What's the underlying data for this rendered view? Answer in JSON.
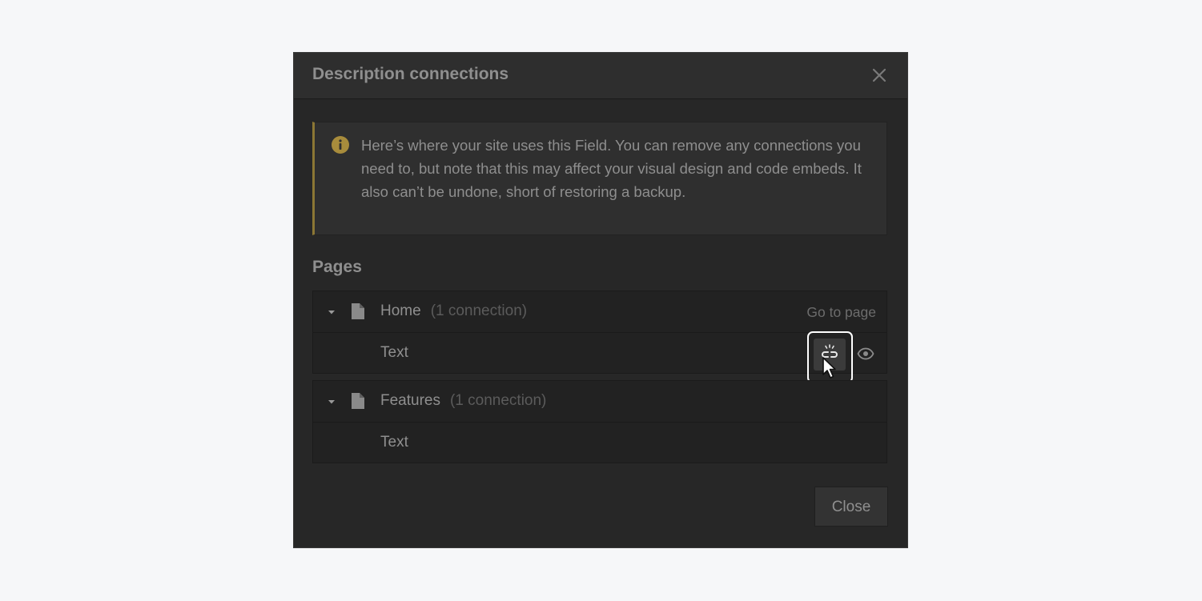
{
  "modal": {
    "title": "Description connections",
    "notice": "Here’s where your site uses this Field. You can remove any connections you need to, but note that this may affect your visual design and code embeds. It also can’t be undone, short of restoring a backup.",
    "notice_color": "#8c7734",
    "section_title": "Pages",
    "groups": [
      {
        "page": "Home",
        "count": "(1 connection)",
        "action": "Go to page",
        "rows": [
          {
            "label": "Text"
          }
        ]
      },
      {
        "page": "Features",
        "count": "(1 connection)",
        "rows": [
          {
            "label": "Text"
          }
        ]
      }
    ],
    "close_label": "Close"
  }
}
